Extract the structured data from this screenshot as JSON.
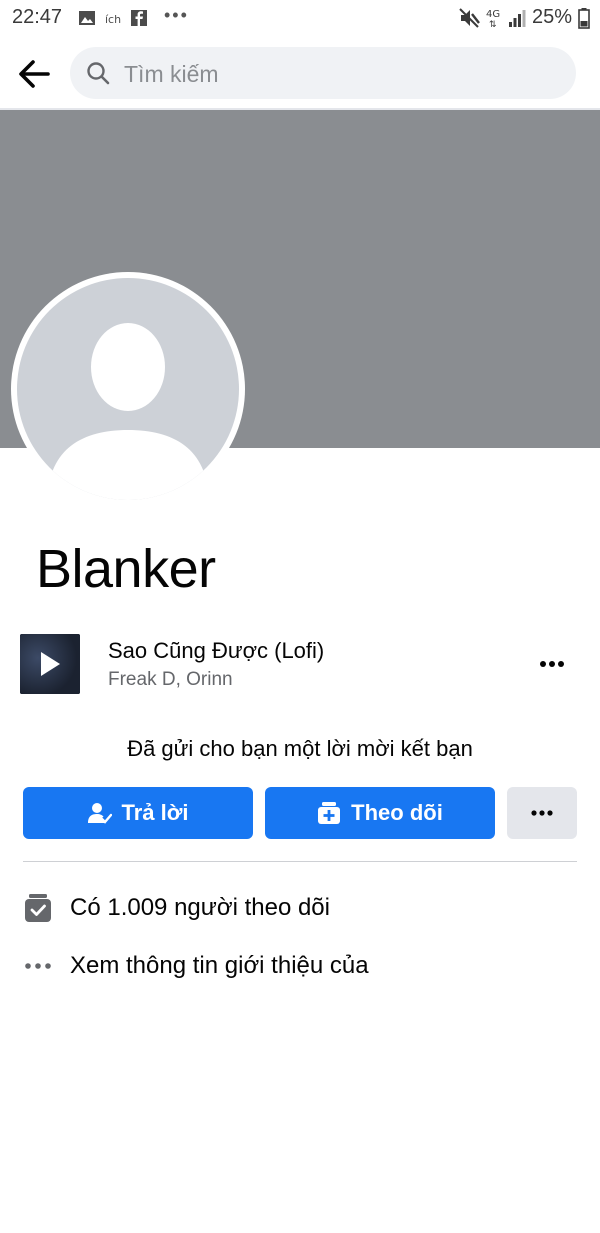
{
  "status_bar": {
    "time": "22:47",
    "network": "4G",
    "battery": "25%",
    "icons_left": [
      "image-icon",
      "app-icon",
      "facebook-icon",
      "more-dots-icon"
    ],
    "icons_right": [
      "mute-icon",
      "signal-icon",
      "battery-icon"
    ]
  },
  "header": {
    "search_placeholder": "Tìm kiếm"
  },
  "profile": {
    "name": "Blanker"
  },
  "music": {
    "title": "Sao Cũng Được (Lofi)",
    "artist": "Freak D, Orinn"
  },
  "friend_request": {
    "text": "Đã gửi cho bạn một lời mời kết bạn"
  },
  "actions": {
    "reply_label": "Trả lời",
    "follow_label": "Theo dõi",
    "more_label": "•••"
  },
  "info": {
    "followers": "Có 1.009 người theo dõi",
    "about": "Xem thông tin giới thiệu của"
  },
  "colors": {
    "accent": "#1877f2",
    "cover": "#8a8d91",
    "avatar_bg": "#cdd1d7",
    "secondary_button": "#e4e6eb"
  }
}
